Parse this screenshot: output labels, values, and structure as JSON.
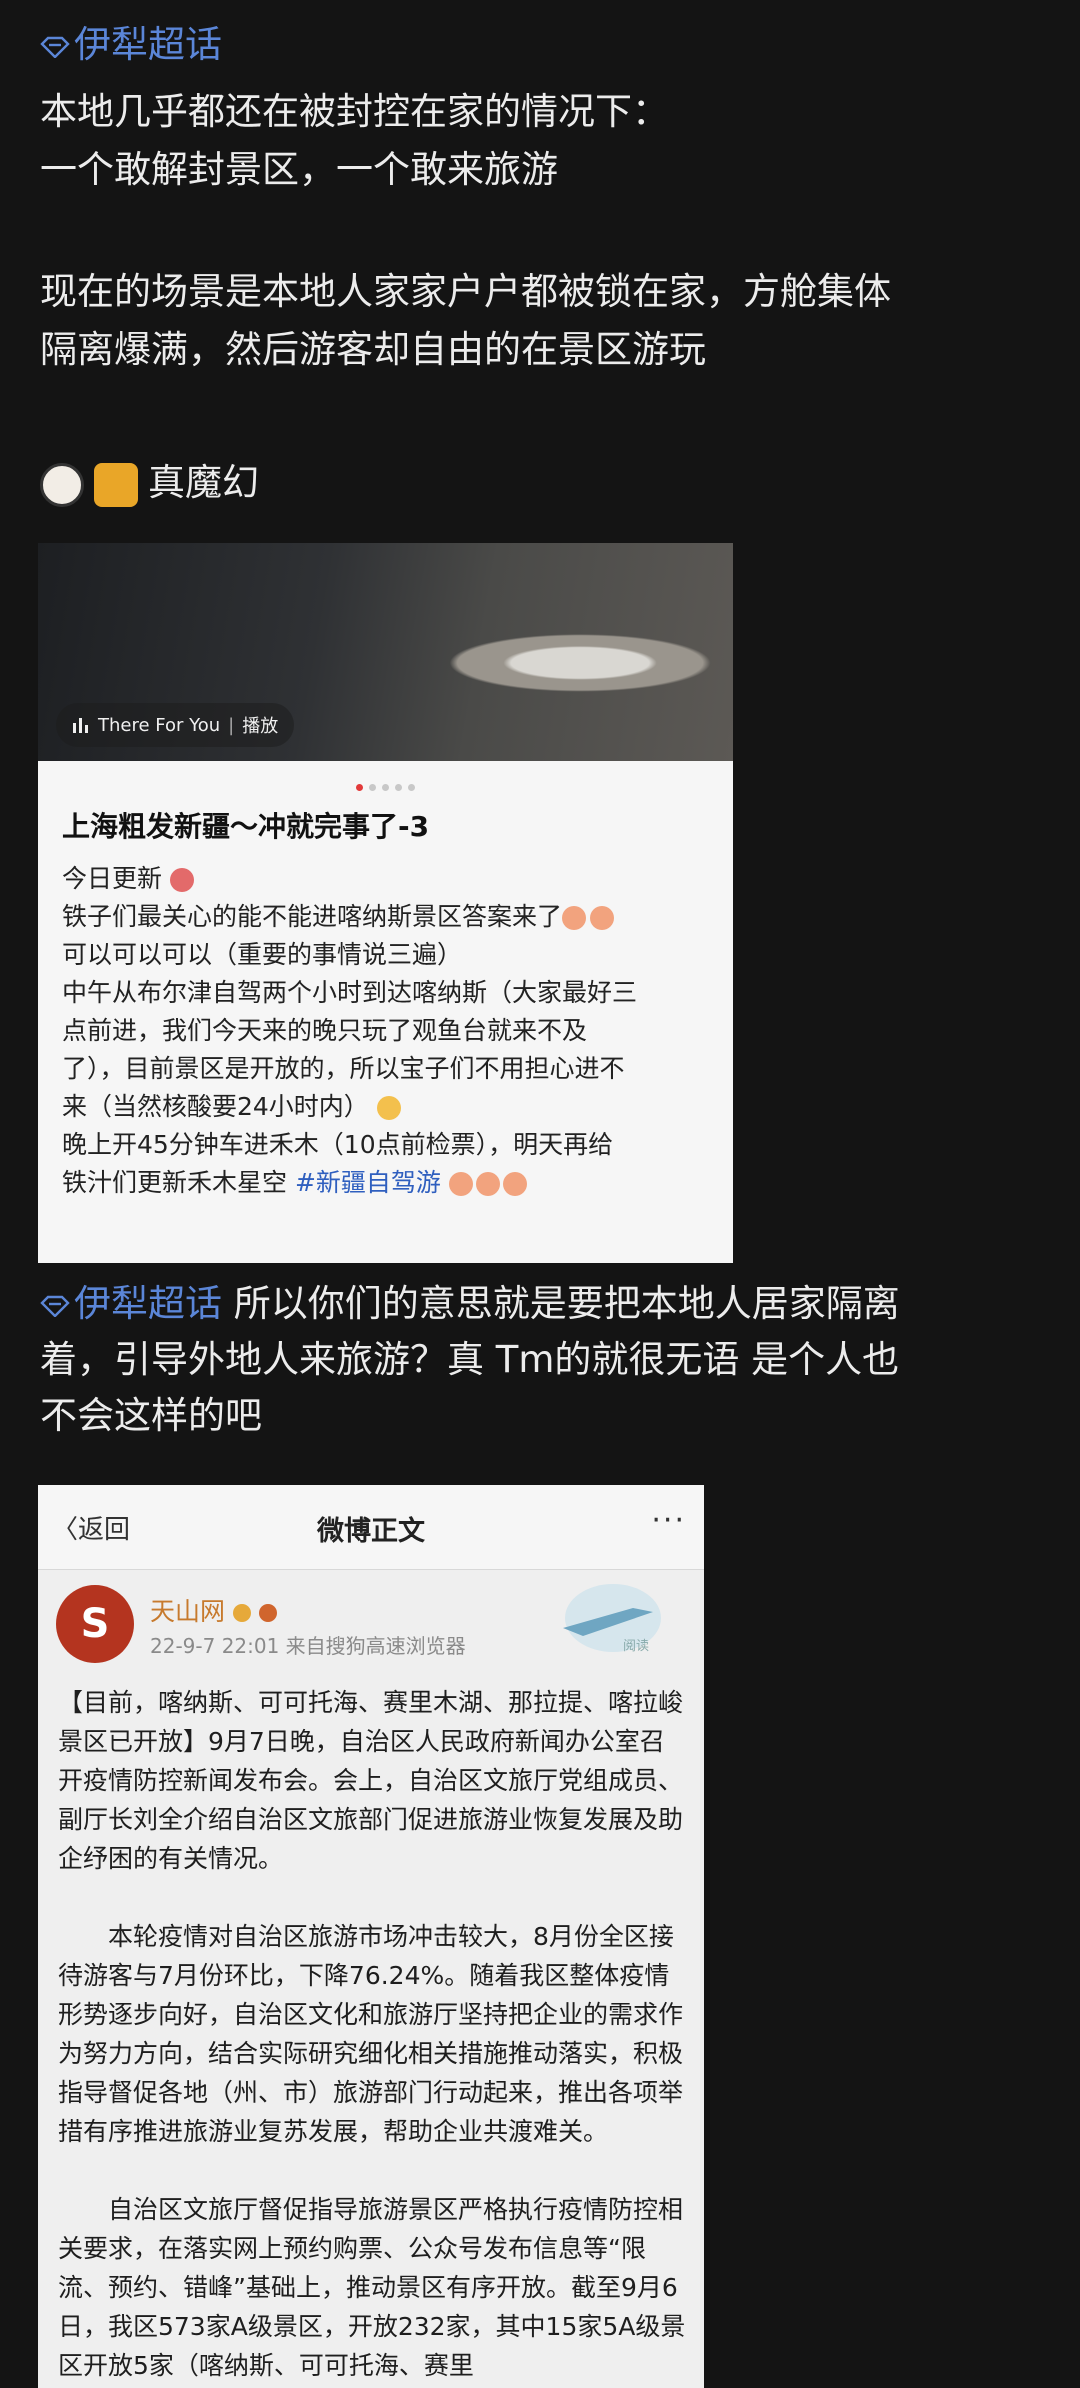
{
  "post1": {
    "handle": "伊犁超话",
    "lines": [
      "本地几乎都还在被封控在家的情况下：",
      "一个敢解封景区，一个敢来旅游",
      "现在的场景是本地人家家户户都被锁在家，方舱集体",
      "隔离爆满，然后游客却自由的在景区游玩",
      "真魔幻"
    ]
  },
  "card1": {
    "music_label": "There For You",
    "play_label": "播放",
    "title": "上海粗发新疆～冲就完事了-3",
    "body": [
      "今日更新",
      "铁子们最关心的能不能进喀纳斯景区答案来了",
      "可以可以可以（重要的事情说三遍）",
      "中午从布尔津自驾两个小时到达喀纳斯（大家最好三",
      "点前进，我们今天来的晚只玩了观鱼台就来不及",
      "了），目前景区是开放的，所以宝子们不用担心进不",
      "来（当然核酸要24小时内）",
      "晚上开45分钟车进禾木（10点前检票），明天再给",
      "铁汁们更新禾木星空"
    ],
    "hashtag": "#新疆自驾游"
  },
  "post2": {
    "handle": "伊犁超话",
    "line1": "所以你们的意思就是要把本地人居家隔离",
    "line2": "着，引导外地人来旅游？真 Tm的就很无语 是个人也",
    "line3": "不会这样的吧"
  },
  "card2": {
    "back_label": "返回",
    "title": "微博正文",
    "more": "···",
    "avatar_text": "S",
    "account_name": "天山网",
    "meta": "22-9-7 22:01  来自搜狗高速浏览器",
    "stamp_text": "阅读",
    "para1": "【目前，喀纳斯、可可托海、赛里木湖、那拉提、喀拉峻景区已开放】9月7日晚，自治区人民政府新闻办公室召开疫情防控新闻发布会。会上，自治区文旅厅党组成员、副厅长刘全介绍自治区文旅部门促进旅游业恢复发展及助企纾困的有关情况。",
    "para2": "本轮疫情对自治区旅游市场冲击较大，8月份全区接待游客与7月份环比，下降76.24%。随着我区整体疫情形势逐步向好，自治区文化和旅游厅坚持把企业的需求作为努力方向，结合实际研究细化相关措施推动落实，积极指导督促各地（州、市）旅游部门行动起来，推出各项举措有序推进旅游业复苏发展，帮助企业共渡难关。",
    "para3": "自治区文旅厅督促指导旅游景区严格执行疫情防控相关要求，在落实网上预约购票、公众号发布信息等“限流、预约、错峰”基础上，推动景区有序开放。截至9月6日，我区573家A级景区，开放232家，其中15家5A级景区开放5家（喀纳斯、可可托海、赛里"
  },
  "colors": {
    "background": "#141414",
    "handle": "#5b86d8",
    "hashtag": "#2f5fbf"
  }
}
